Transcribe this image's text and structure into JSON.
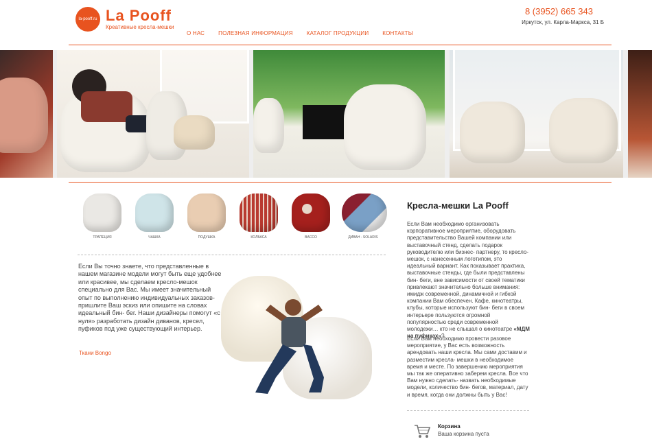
{
  "header": {
    "logo_badge": "la-pooff.ru",
    "logo_name": "La Pooff",
    "logo_slogan": "Креативные кресла-мешки",
    "nav": [
      {
        "label": "О НАС"
      },
      {
        "label": "ПОЛЕЗНАЯ ИНФОРМАЦИЯ"
      },
      {
        "label": "КАТАЛОГ ПРОДУКЦИИ"
      },
      {
        "label": "КОНТАКТЫ"
      }
    ],
    "phone": "8 (3952) 665 343",
    "address": "Иркутск, ул. Карла-Маркса, 31 Б"
  },
  "colors": {
    "accent": "#e8531f"
  },
  "catalog": [
    {
      "label": "Трапеция",
      "color": "#eae8e4"
    },
    {
      "label": "Чашка",
      "color": "#cfe4e8"
    },
    {
      "label": "Подушка",
      "color": "#e9cdb2"
    },
    {
      "label": "Колбаса",
      "color": "#b93a30"
    },
    {
      "label": "Bacco",
      "color": "#a5201d"
    },
    {
      "label": "Диван - Solaris",
      "color": "#8a2030"
    }
  ],
  "main": {
    "text": "Если Вы точно знаете, что представленные в нашем магазине модели могут быть еще удобнее или красивее, мы сделаем кресло-мешок специально для Вас. Мы имеет значительный опыт по выполнению индивидуальных заказов- пришлите Ваш эскиз или опишите на словах идеальный бин- бег. Наши дизайнеры помогут «с нуля» разработать дизайн диванов, кресел, пуфиков под уже существующий интерьер.",
    "fabrics_link": "Ткани Bongo"
  },
  "right": {
    "title": "Кресла-мешки La Pooff",
    "p1_text": "Если Вам необходимо организовать корпоративное мероприятие, оборудовать представительство Вашей компании или выставочный стенд, сделать подарок руководителю или бизнес- партнеру, то кресло-мешок, с нанесенным логотипом, это идеальный вариант. Как показывает практика, выставочные стенды, где были представлены бин- беги, вне зависимости от своей тематики привлекают значительно больше внимания: имидж современной, динамичной и гибкой компании Вам обеспечен. Кафе, кинотеатры, клубы, которые используют бин- беги в своем интерьере пользуются огромной популярностью среди современной молодежи… кто не слышал о кинотеатре ",
    "p1_bold": "«МДМ на пуфиках»",
    "p1_end": "?",
    "p2": "Если Вам необходимо провести разовое мероприятие, у Вас есть возможность арендовать наши кресла. Мы сами доставим и разместим кресла- мешки в необходимое время и месте. По завершению мероприятия мы так же оперативно заберем кресла. Все что Вам нужно сделать- назвать необходимые модели, количество бин- бегов, материал, дату и время, когда они должны быть у Вас!"
  },
  "cart": {
    "title": "Корзина",
    "status": "Ваша корзина пуста"
  }
}
